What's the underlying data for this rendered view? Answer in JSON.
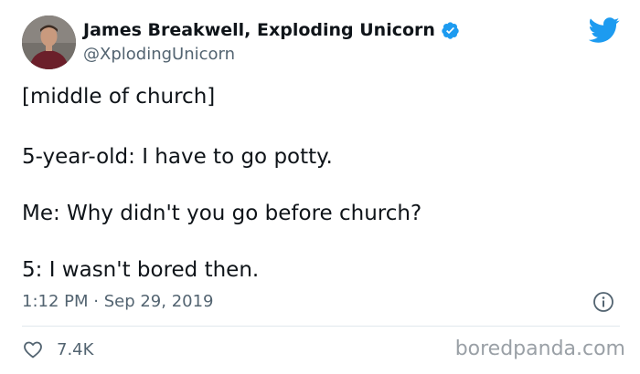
{
  "tweet": {
    "author_name": "James Breakwell, Exploding Unicorn",
    "handle": "@XplodingUnicorn",
    "verified": true,
    "lines": [
      "[middle of church]",
      "5-year-old: I have to go potty.",
      "Me: Why didn't you go before church?",
      "5: I wasn't bored then."
    ],
    "timestamp": "1:12 PM · Sep 29, 2019",
    "likes": "7.4K"
  },
  "watermark": "boredpanda.com",
  "colors": {
    "twitter_blue": "#1d9bf0",
    "text": "#0f1419",
    "secondary": "#536471"
  },
  "icons": [
    "avatar",
    "verified-badge-icon",
    "twitter-bird-icon",
    "info-icon",
    "heart-icon"
  ]
}
